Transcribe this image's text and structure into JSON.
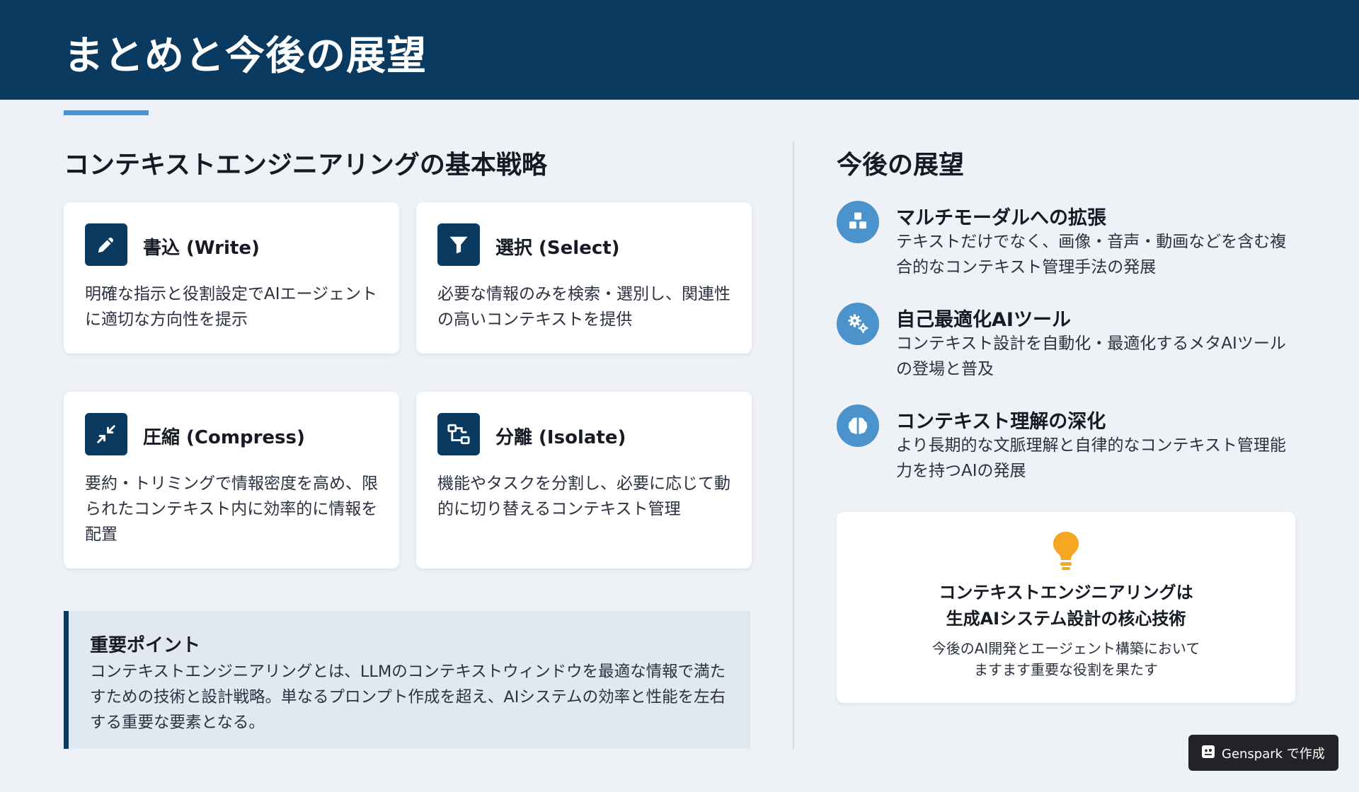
{
  "header": {
    "title": "まとめと今後の展望"
  },
  "strategy": {
    "title": "コンテキストエンジニアリングの基本戦略",
    "cards": [
      {
        "title": "書込 (Write)",
        "desc": "明確な指示と役割設定でAIエージェントに適切な方向性を提示",
        "icon": "pencil-icon"
      },
      {
        "title": "選択 (Select)",
        "desc": "必要な情報のみを検索・選別し、関連性の高いコンテキストを提供",
        "icon": "filter-icon"
      },
      {
        "title": "圧縮 (Compress)",
        "desc": "要約・トリミングで情報密度を高め、限られたコンテキスト内に効率的に情報を配置",
        "icon": "compress-icon"
      },
      {
        "title": "分離 (Isolate)",
        "desc": "機能やタスクを分割し、必要に応じて動的に切り替えるコンテキスト管理",
        "icon": "split-icon"
      }
    ]
  },
  "keypoint": {
    "title": "重要ポイント",
    "body": "コンテキストエンジニアリングとは、LLMのコンテキストウィンドウを最適な情報で満たすための技術と設計戦略。単なるプロンプト作成を超え、AIシステムの効率と性能を左右する重要な要素となる。"
  },
  "outlook": {
    "title": "今後の展望",
    "items": [
      {
        "title": "マルチモーダルへの拡張",
        "desc": "テキストだけでなく、画像・音声・動画などを含む複合的なコンテキスト管理手法の発展",
        "icon": "cubes-icon"
      },
      {
        "title": "自己最適化AIツール",
        "desc": "コンテキスト設計を自動化・最適化するメタAIツールの登場と普及",
        "icon": "gears-icon"
      },
      {
        "title": "コンテキスト理解の深化",
        "desc": "より長期的な文脈理解と自律的なコンテキスト管理能力を持つAIの発展",
        "icon": "brain-icon"
      }
    ]
  },
  "summary": {
    "headline_line1": "コンテキストエンジニアリングは",
    "headline_line2": "生成AIシステム設計の核心技術",
    "sub_line1": "今後のAI開発とエージェント構築において",
    "sub_line2": "ますます重要な役割を果たす",
    "icon": "lightbulb-icon"
  },
  "badge": {
    "label": "Genspark で作成",
    "icon": "genspark-icon"
  },
  "colors": {
    "navy": "#0b3a61",
    "accent_blue": "#4a93cc",
    "bulb": "#f5a623",
    "background": "#eef2f7"
  }
}
